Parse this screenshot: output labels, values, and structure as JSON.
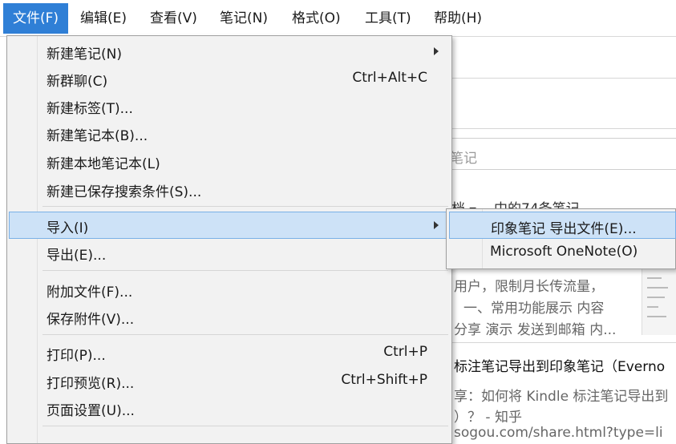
{
  "menubar": {
    "items": [
      "文件(F)",
      "编辑(E)",
      "查看(V)",
      "笔记(N)",
      "格式(O)",
      "工具(T)",
      "帮助(H)"
    ]
  },
  "background": {
    "search_placeholder": "笔记",
    "notebook_scope": "档",
    "note_count": "中的74条笔记",
    "snippet_1": "用户，限制月长传流量，",
    "snippet_2": "一、常用功能展示 内容",
    "snippet_3": "分享 演示 发送到邮箱 内...",
    "note_title": "标注笔记导出到印象笔记（Everno",
    "note_line_1": "享：如何将 Kindle 标注笔记导出到",
    "note_line_2": "）？ - 知乎",
    "note_url": "sogou.com/share.html?type=li"
  },
  "file_menu": {
    "items": [
      {
        "label": "新建笔记(N)",
        "shortcut": "",
        "submenu": true
      },
      {
        "label": "新群聊(C)",
        "shortcut": "Ctrl+Alt+C",
        "submenu": false
      },
      {
        "label": "新建标签(T)...",
        "shortcut": "",
        "submenu": false
      },
      {
        "label": "新建笔记本(B)...",
        "shortcut": "",
        "submenu": false
      },
      {
        "label": "新建本地笔记本(L)",
        "shortcut": "",
        "submenu": false
      },
      {
        "label": "新建已保存搜索条件(S)...",
        "shortcut": "",
        "submenu": false
      },
      {
        "label": "导入(I)",
        "shortcut": "",
        "submenu": true
      },
      {
        "label": "导出(E)...",
        "shortcut": "",
        "submenu": false
      },
      {
        "label": "附加文件(F)...",
        "shortcut": "",
        "submenu": false
      },
      {
        "label": "保存附件(V)...",
        "shortcut": "",
        "submenu": false
      },
      {
        "label": "打印(P)...",
        "shortcut": "Ctrl+P",
        "submenu": false
      },
      {
        "label": "打印预览(R)...",
        "shortcut": "Ctrl+Shift+P",
        "submenu": false
      },
      {
        "label": "页面设置(U)...",
        "shortcut": "",
        "submenu": false
      }
    ]
  },
  "import_submenu": {
    "items": [
      "印象笔记 导出文件(E)...",
      "Microsoft OneNote(O)"
    ]
  },
  "colors": {
    "active_menu": "#2f7fd6",
    "highlight": "#cde2f7",
    "menu_bg": "#f2f2f2"
  }
}
